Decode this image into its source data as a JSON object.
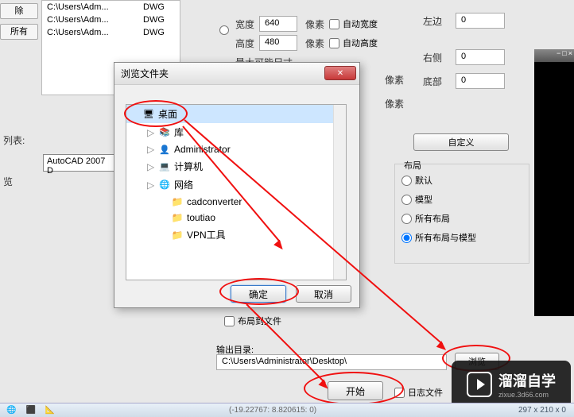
{
  "file_list": [
    {
      "path": "C:\\Users\\Adm...",
      "type": "DWG"
    },
    {
      "path": "C:\\Users\\Adm...",
      "type": "DWG"
    },
    {
      "path": "C:\\Users\\Adm...",
      "type": "DWG"
    }
  ],
  "buttons": {
    "clear": "除",
    "all": "所有",
    "custom": "自定义",
    "browse": "浏览",
    "start": "开始",
    "ok": "确定",
    "cancel": "取消"
  },
  "labels": {
    "list": "列表:",
    "width": "宽度",
    "height": "高度",
    "max_size": "最大可能尺寸",
    "pixels": "像素",
    "auto_width": "自动宽度",
    "auto_height": "自动高度",
    "left": "左边",
    "right": "右侧",
    "bottom": "底部",
    "layout": "布局",
    "layout_to_file": "布局到文件",
    "output_dir": "输出目录:",
    "log_file": "日志文件",
    "browse_label": "览"
  },
  "dropdowns": {
    "autocad": "AutoCAD 2007 D"
  },
  "fields": {
    "width": "640",
    "height": "480",
    "left": "0",
    "right": "0",
    "bottom": "0",
    "output_path": "C:\\Users\\Administrator\\Desktop\\"
  },
  "radios": {
    "default": "默认",
    "model": "模型",
    "all_layouts": "所有布局",
    "all_layouts_model": "所有布局与模型"
  },
  "dialog": {
    "title": "浏览文件夹",
    "close": "✕"
  },
  "tree": [
    {
      "label": "桌面",
      "icon": "monitor",
      "selected": true,
      "indent": 0,
      "arrow": ""
    },
    {
      "label": "库",
      "icon": "library",
      "selected": false,
      "indent": 1,
      "arrow": "▷"
    },
    {
      "label": "Administrator",
      "icon": "user",
      "selected": false,
      "indent": 1,
      "arrow": "▷"
    },
    {
      "label": "计算机",
      "icon": "computer",
      "selected": false,
      "indent": 1,
      "arrow": "▷"
    },
    {
      "label": "网络",
      "icon": "network",
      "selected": false,
      "indent": 1,
      "arrow": "▷"
    },
    {
      "label": "cadconverter",
      "icon": "folder",
      "selected": false,
      "indent": 2,
      "arrow": ""
    },
    {
      "label": "toutiao",
      "icon": "folder",
      "selected": false,
      "indent": 2,
      "arrow": ""
    },
    {
      "label": "VPN工具",
      "icon": "folder",
      "selected": false,
      "indent": 2,
      "arrow": ""
    }
  ],
  "watermark": {
    "big": "溜溜自学",
    "small": "zixue.3d66.com"
  },
  "status": {
    "coords": "(-19.22767: 8.820615: 0)",
    "dims": "297 x 210 x 0"
  }
}
